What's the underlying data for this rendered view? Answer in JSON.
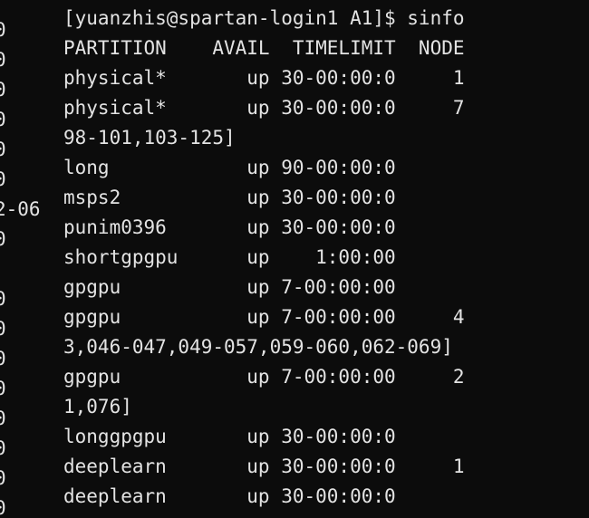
{
  "terminal": {
    "background": "#0c0c0c",
    "foreground": "#e3e3e3",
    "gutter": [
      "0",
      "0",
      "0",
      "0",
      "0",
      "0",
      "2-06",
      "0",
      "",
      "0",
      "0",
      "0",
      "0",
      "0",
      "0",
      "0",
      "0"
    ],
    "lines": [
      "[yuanzhis@spartan-login1 A1]$ sinfo",
      "PARTITION    AVAIL  TIMELIMIT  NODE",
      "physical*       up 30-00:00:0     1",
      "physical*       up 30-00:00:0     7",
      "98-101,103-125]",
      "long            up 90-00:00:0",
      "msps2           up 30-00:00:0",
      "punim0396       up 30-00:00:0",
      "shortgpgpu      up    1:00:00",
      "gpgpu           up 7-00:00:00",
      "gpgpu           up 7-00:00:00     4",
      "3,046-047,049-057,059-060,062-069]",
      "gpgpu           up 7-00:00:00     2",
      "1,076]",
      "longgpgpu       up 30-00:00:0",
      "deeplearn       up 30-00:00:0     1",
      "deeplearn       up 30-00:00:0"
    ]
  }
}
